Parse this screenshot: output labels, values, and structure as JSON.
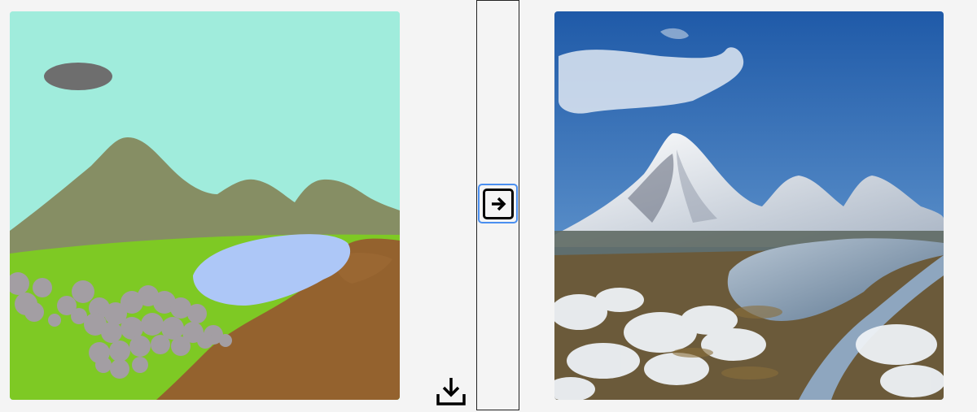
{
  "toolbar": {
    "download_icon": "download-icon",
    "generate_icon": "arrow-right-square-icon"
  },
  "sketch_canvas": {
    "colors": {
      "sky": "#a0ecdc",
      "cloud": "#6e6e6e",
      "mountain": "#868e64",
      "grass": "#7ec924",
      "water": "#adc7f7",
      "rocks": "#a39ea3",
      "dirt": "#94622e"
    }
  },
  "generated_image": {
    "colors": {
      "sky_top": "#1f5aa8",
      "sky_bottom": "#7fb0de",
      "snow": "#eef2f6",
      "rock": "#5b6270",
      "ground": "#6b5a3a",
      "water": "#8ea6bf"
    }
  }
}
